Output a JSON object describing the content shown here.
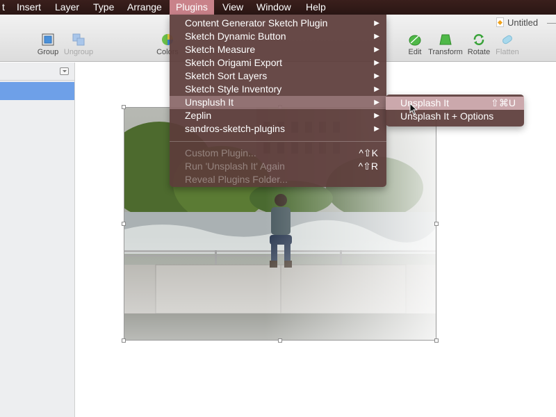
{
  "menubar": {
    "items": [
      "t",
      "Insert",
      "Layer",
      "Type",
      "Arrange",
      "Plugins",
      "View",
      "Window",
      "Help"
    ],
    "active": "Plugins"
  },
  "toolbar": {
    "group": "Group",
    "ungroup": "Ungroup",
    "colors": "Colors",
    "edit": "Edit",
    "transform": "Transform",
    "rotate": "Rotate",
    "flatten": "Flatten",
    "document_title": "Untitled",
    "title_suffix": "—"
  },
  "plugins_menu": {
    "items": [
      {
        "label": "Content Generator Sketch Plugin",
        "submenu": true
      },
      {
        "label": "Sketch Dynamic Button",
        "submenu": true
      },
      {
        "label": "Sketch Measure",
        "submenu": true
      },
      {
        "label": "Sketch Origami Export",
        "submenu": true
      },
      {
        "label": "Sketch Sort Layers",
        "submenu": true
      },
      {
        "label": "Sketch Style Inventory",
        "submenu": true
      },
      {
        "label": "Unsplush It",
        "submenu": true,
        "highlighted": true
      },
      {
        "label": "Zeplin",
        "submenu": true
      },
      {
        "label": "sandros-sketch-plugins",
        "submenu": true
      }
    ],
    "bottom_items": [
      {
        "label": "Custom Plugin...",
        "shortcut": "^⇧K"
      },
      {
        "label": "Run 'Unsplash It' Again",
        "shortcut": "^⇧R"
      },
      {
        "label": "Reveal Plugins Folder...",
        "shortcut": ""
      }
    ],
    "arrow_glyph": "▶"
  },
  "submenu": {
    "items": [
      {
        "label": "Unsplash It",
        "shortcut": "⇧⌘U",
        "highlighted": true
      },
      {
        "label": "Unsplash It + Options",
        "shortcut": ""
      }
    ]
  },
  "colors": {
    "menubar_bg": "#2a1614",
    "menu_bg": "#5c3c3a",
    "selected_layer": "#6ea0e8",
    "active_menu": "#c9828a"
  }
}
